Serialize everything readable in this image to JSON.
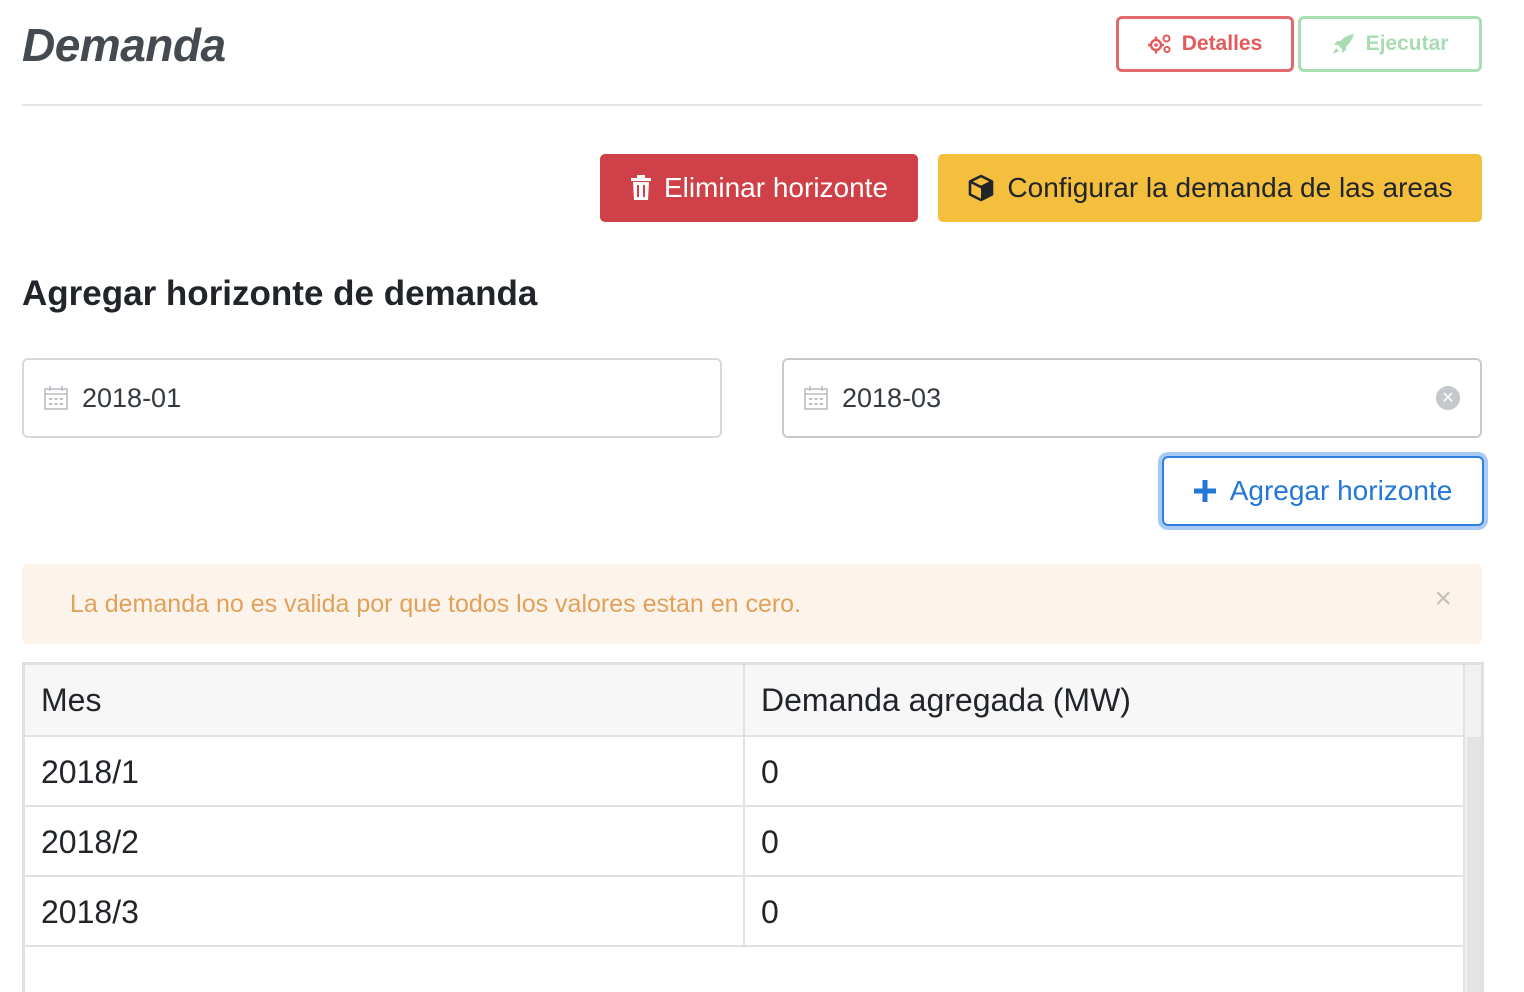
{
  "header": {
    "title": "Demanda",
    "details_label": "Detalles",
    "run_label": "Ejecutar"
  },
  "actions": {
    "delete_label": "Eliminar horizonte",
    "configure_label": "Configurar la demanda de las areas"
  },
  "add_section": {
    "title": "Agregar horizonte de demanda",
    "start_date": "2018-01",
    "end_date": "2018-03",
    "add_label": "Agregar horizonte"
  },
  "alert": {
    "message": "La demanda no es valida por que todos los valores estan en cero."
  },
  "table": {
    "columns": [
      "Mes",
      "Demanda agregada (MW)"
    ],
    "rows": [
      [
        "2018/1",
        "0"
      ],
      [
        "2018/2",
        "0"
      ],
      [
        "2018/3",
        "0"
      ]
    ]
  },
  "colors": {
    "danger": "#cf4048",
    "warning": "#f5bf3e",
    "primary": "#2377d8",
    "details": "#e25a5a",
    "run": "#a9dcb3",
    "alert_text": "#e1a15a"
  },
  "icons": {
    "details": "gears-icon",
    "run": "rocket-icon",
    "delete": "trash-icon",
    "configure": "cube-icon",
    "date": "calendar-icon",
    "clear": "clear-circle-icon",
    "add": "plus-icon",
    "alert_close": "close-icon"
  }
}
